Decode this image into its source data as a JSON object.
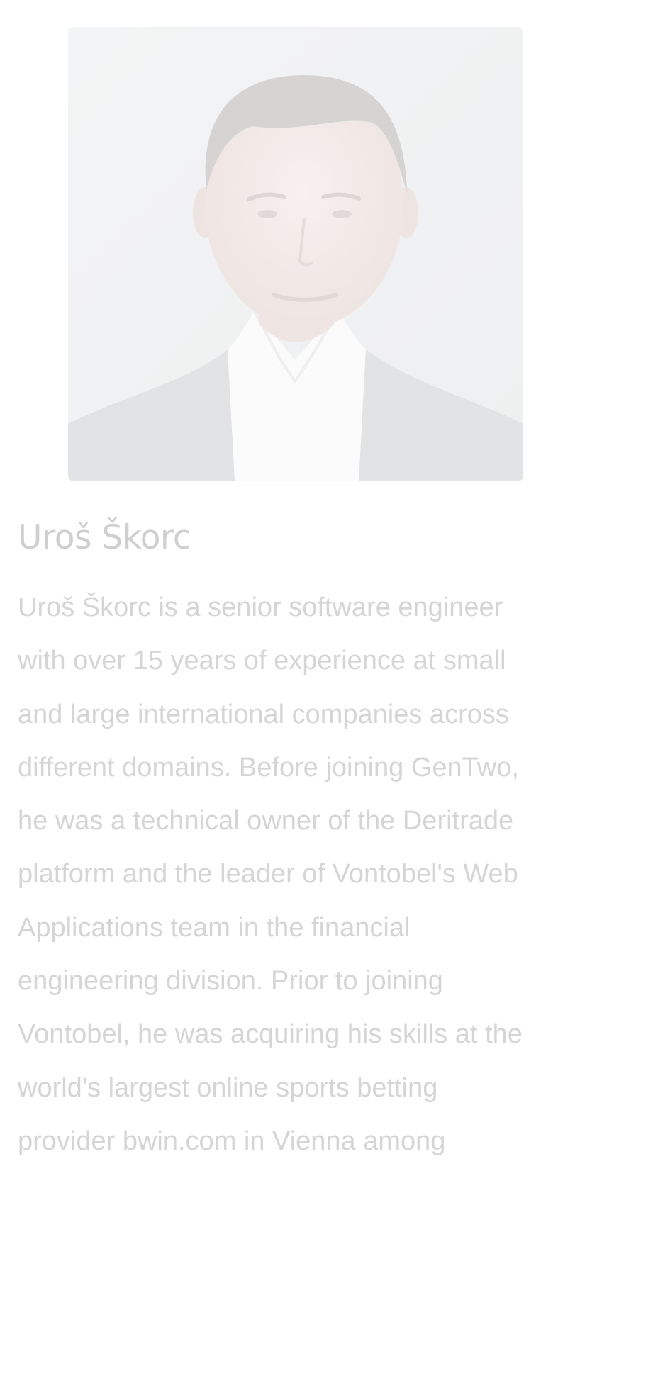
{
  "profile": {
    "name": "Uroš Škorc",
    "photo_alt": "portrait-photo",
    "bio_lines": [
      "Uroš Škorc is a senior software engineer",
      "with over 15 years of experience at small",
      "and large international companies across",
      "different domains. Before joining GenTwo,",
      "he was a technical owner of the Deritrade",
      "platform and the leader of Vontobel's Web",
      "Applications team in the financial",
      "engineering division. Prior to joining",
      "Vontobel, he was acquiring his skills at the",
      "world's largest online sports betting",
      "provider bwin.com in Vienna among"
    ]
  },
  "colors": {
    "background": "#ffffff",
    "name_text": "#cfcfcf",
    "bio_text": "#d5d5d5",
    "photo_background": "#f2f3f4"
  }
}
